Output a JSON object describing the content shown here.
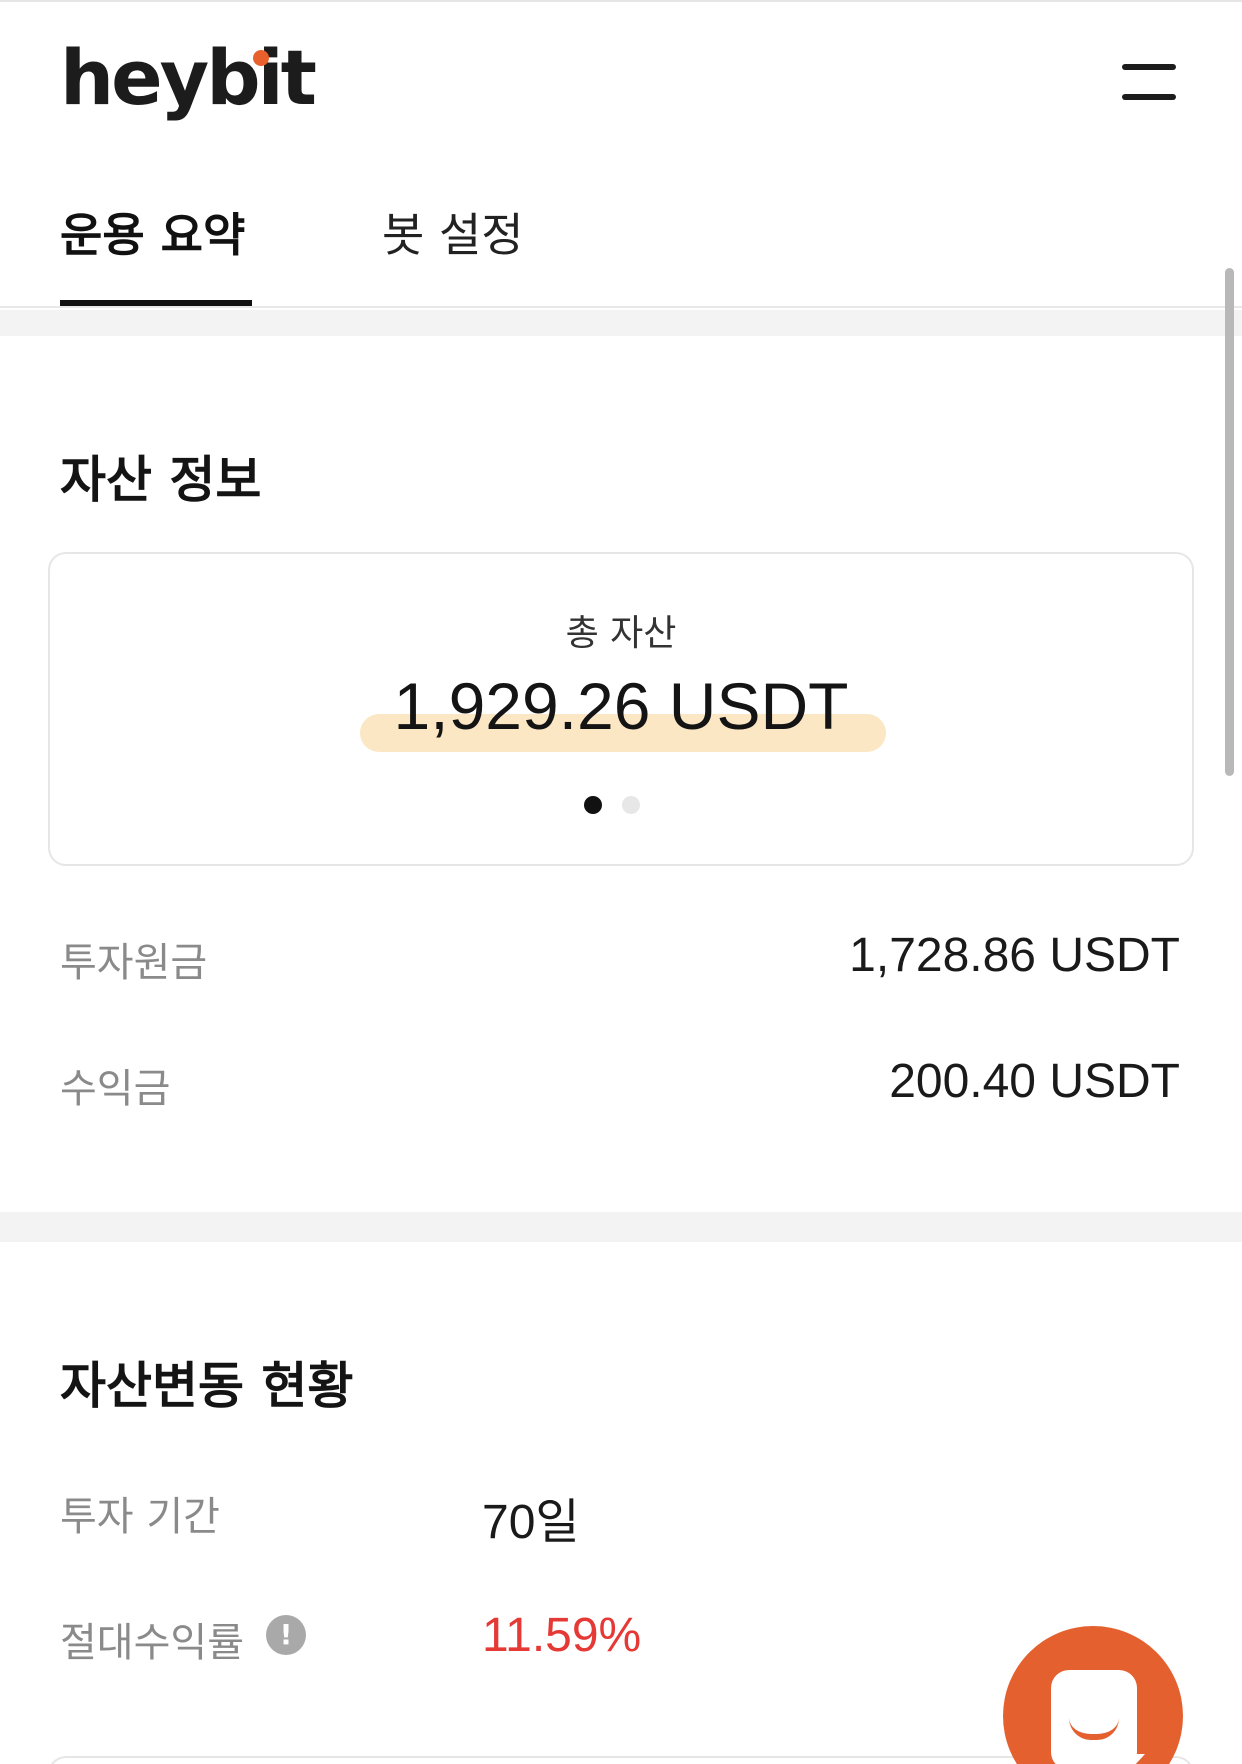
{
  "header": {
    "logo_text": "heybit",
    "menu_icon": "hamburger-menu-icon"
  },
  "tabs": [
    {
      "label": "운용 요약",
      "active": true
    },
    {
      "label": "봇 설정",
      "active": false
    }
  ],
  "asset_info": {
    "title": "자산 정보",
    "card": {
      "label": "총 자산",
      "value": "1,929.26 USDT",
      "highlight_color": "#fbe7c4",
      "page_count": 2,
      "current_page": 1
    },
    "rows": [
      {
        "label": "투자원금",
        "value": "1,728.86 USDT"
      },
      {
        "label": "수익금",
        "value": "200.40 USDT"
      }
    ]
  },
  "asset_change": {
    "title": "자산변동 현황",
    "rows": [
      {
        "label": "투자 기간",
        "value": "70일"
      },
      {
        "label": "절대수익률",
        "value": "11.59%",
        "value_color": "#e53935",
        "icon": "info-icon"
      }
    ]
  },
  "chat": {
    "icon": "chat-icon",
    "color": "#e4602f"
  }
}
